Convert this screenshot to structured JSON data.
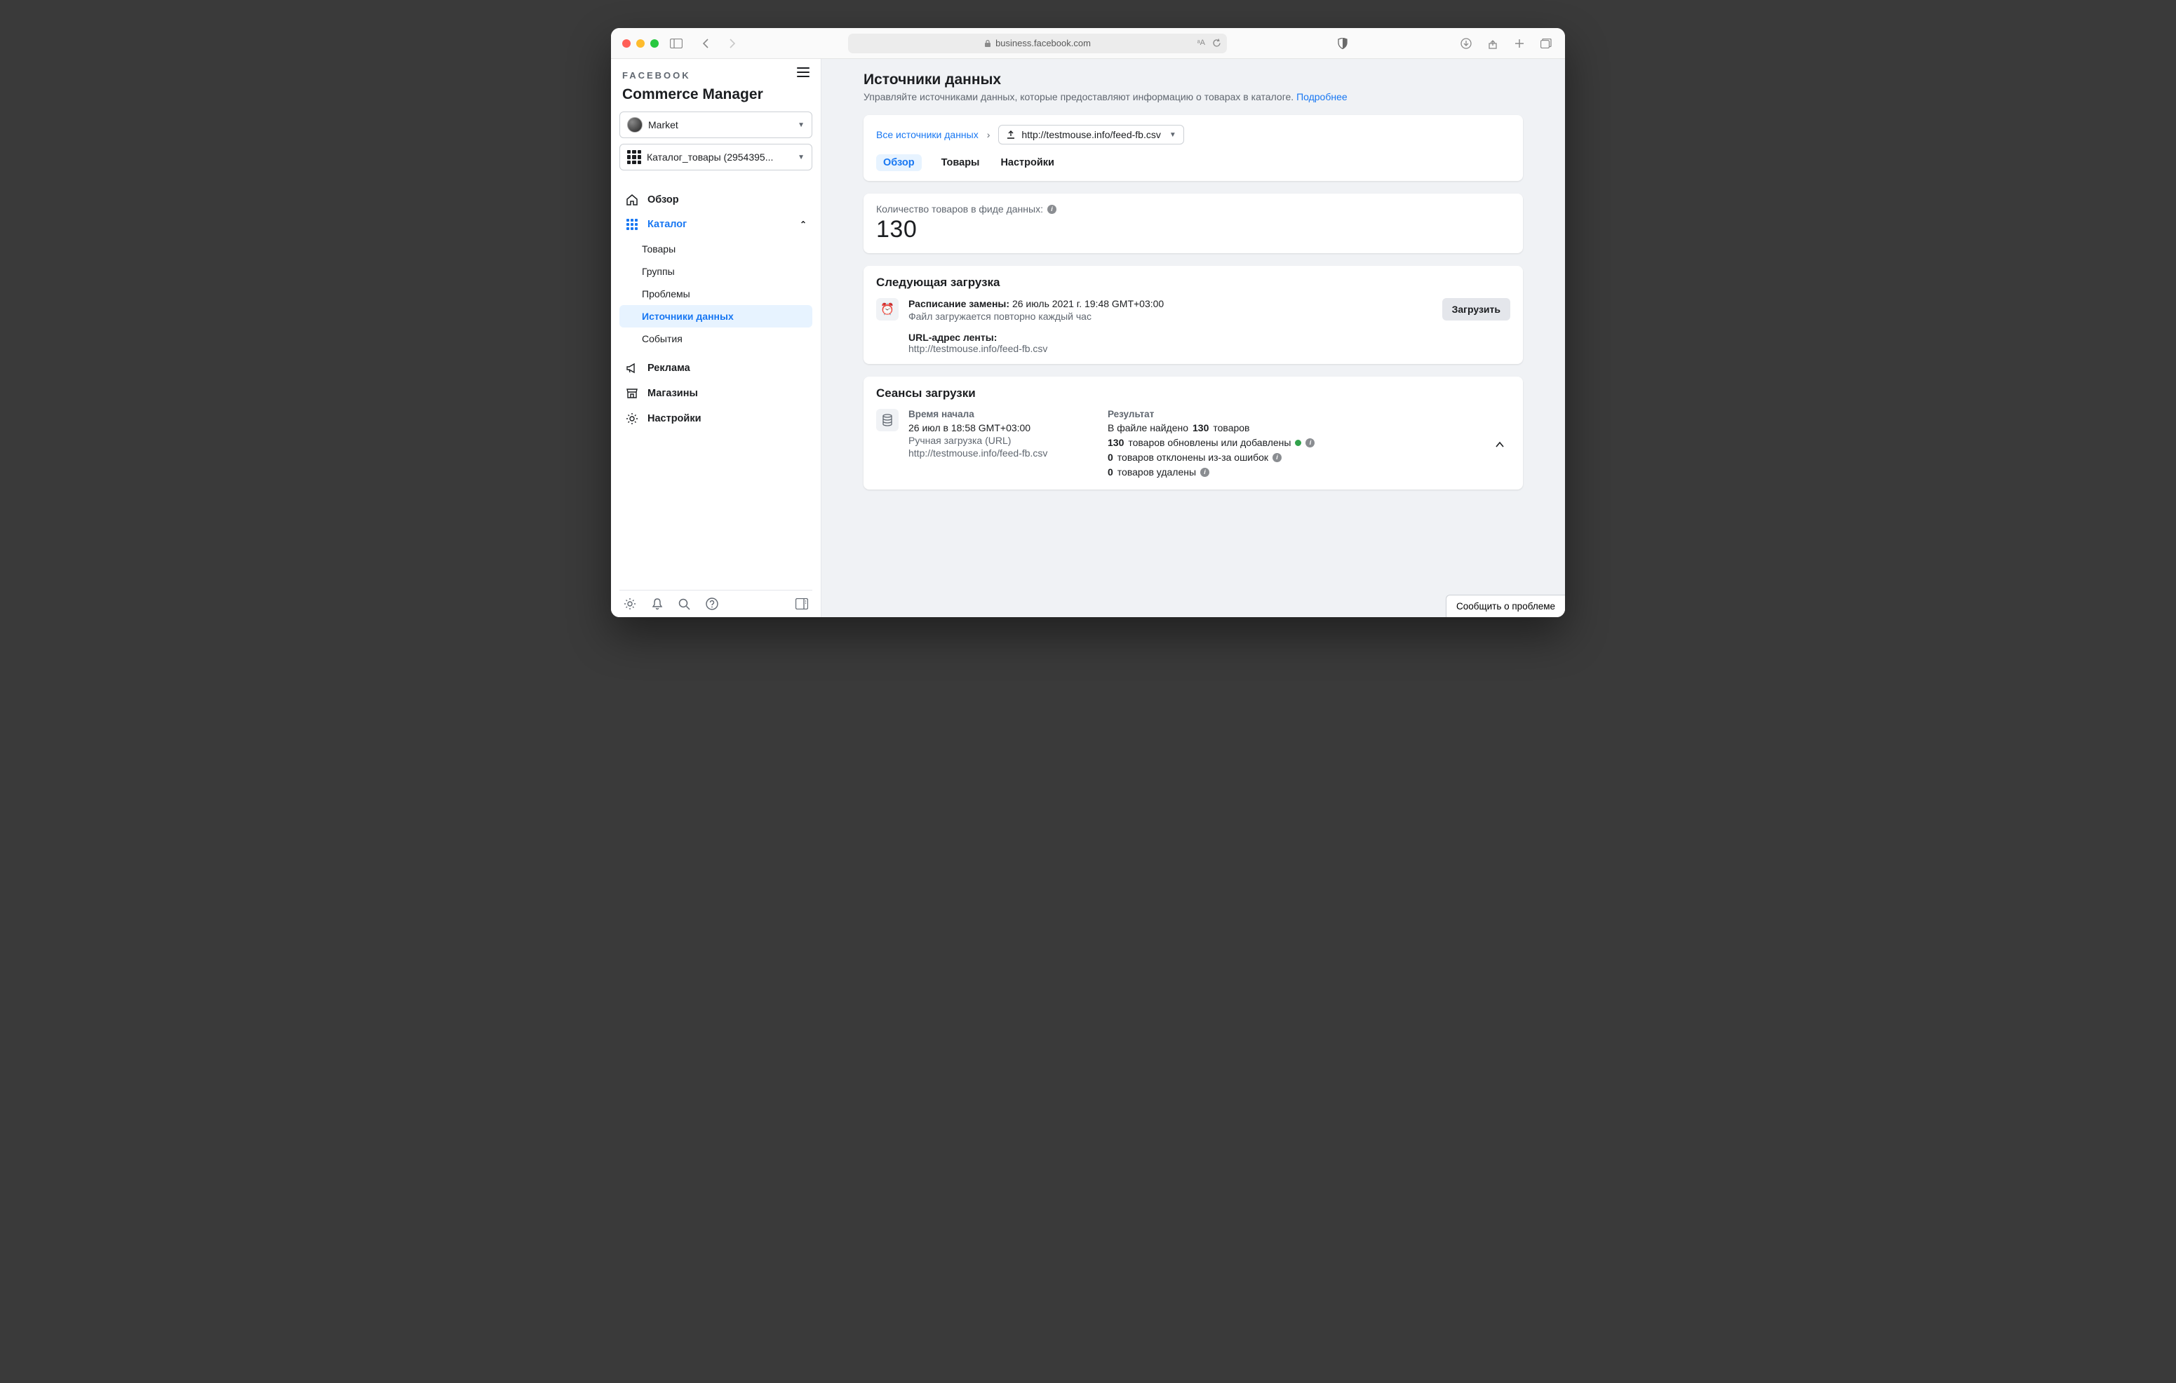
{
  "browser": {
    "url": "business.facebook.com"
  },
  "sidebar": {
    "brand": "FACEBOOK",
    "product": "Commerce Manager",
    "business_select": "Market",
    "catalog_select": "Каталог_товары (2954395...",
    "nav": {
      "overview": "Обзор",
      "catalog": "Каталог",
      "catalog_items": {
        "products": "Товары",
        "groups": "Группы",
        "issues": "Проблемы",
        "data_sources": "Источники данных",
        "events": "События"
      },
      "ads": "Реклама",
      "shops": "Магазины",
      "settings": "Настройки"
    }
  },
  "page": {
    "title": "Источники данных",
    "subtitle": "Управляйте источниками данных, которые предоставляют информацию о товарах в каталоге.",
    "learn_more": "Подробнее"
  },
  "breadcrumb": {
    "all_sources": "Все источники данных",
    "feed_url": "http://testmouse.info/feed-fb.csv"
  },
  "tabs": {
    "overview": "Обзор",
    "products": "Товары",
    "settings": "Настройки"
  },
  "metric": {
    "label": "Количество товаров в фиде данных:",
    "value": "130"
  },
  "next_upload": {
    "title": "Следующая загрузка",
    "schedule_label": "Расписание замены:",
    "schedule_value": "26 июль 2021 г. 19:48 GMT+03:00",
    "frequency": "Файл загружается повторно каждый час",
    "url_label": "URL-адрес ленты:",
    "url_value": "http://testmouse.info/feed-fb.csv",
    "button": "Загрузить"
  },
  "sessions": {
    "title": "Сеансы загрузки",
    "start_header": "Время начала",
    "start_time": "26 июл в 18:58 GMT+03:00",
    "method": "Ручная загрузка (URL)",
    "url": "http://testmouse.info/feed-fb.csv",
    "result_header": "Результат",
    "found_prefix": "В файле найдено",
    "found_count": "130",
    "found_suffix": "товаров",
    "updated_count": "130",
    "updated_suffix": "товаров обновлены или добавлены",
    "rejected_count": "0",
    "rejected_suffix": "товаров отклонены из-за ошибок",
    "deleted_count": "0",
    "deleted_suffix": "товаров удалены"
  },
  "report_button": "Сообщить о проблеме"
}
